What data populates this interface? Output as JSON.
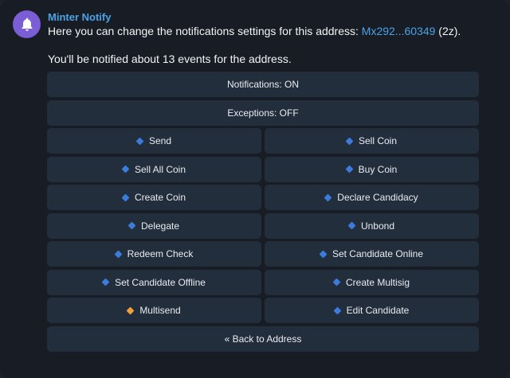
{
  "message": {
    "sender": "Minter Notify",
    "line1_prefix": "Here you can change the notifications settings for this address: ",
    "address_link": "Mx292...60349",
    "line1_suffix": " (2z).",
    "line2": "You'll be notified about 13 events for the address."
  },
  "keyboard": {
    "notifications": "Notifications: ON",
    "exceptions": "Exceptions: OFF",
    "send": "Send",
    "sell_coin": "Sell Coin",
    "sell_all_coin": "Sell All Coin",
    "buy_coin": "Buy Coin",
    "create_coin": "Create Coin",
    "declare_candidacy": "Declare Candidacy",
    "delegate": "Delegate",
    "unbond": "Unbond",
    "redeem_check": "Redeem Check",
    "set_candidate_online": "Set Candidate Online",
    "set_candidate_offline": "Set Candidate Offline",
    "create_multisig": "Create Multisig",
    "multisend": "Multisend",
    "edit_candidate": "Edit Candidate",
    "back": "« Back to Address"
  },
  "colors": {
    "enabled_icon": "#3b7bdb",
    "disabled_icon": "#f0a23a",
    "link": "#4ca3e6",
    "avatar": "#7b5dd6"
  },
  "icons": {
    "avatar": "bell-icon",
    "enabled": "blue-diamond-icon",
    "disabled": "orange-diamond-icon"
  }
}
